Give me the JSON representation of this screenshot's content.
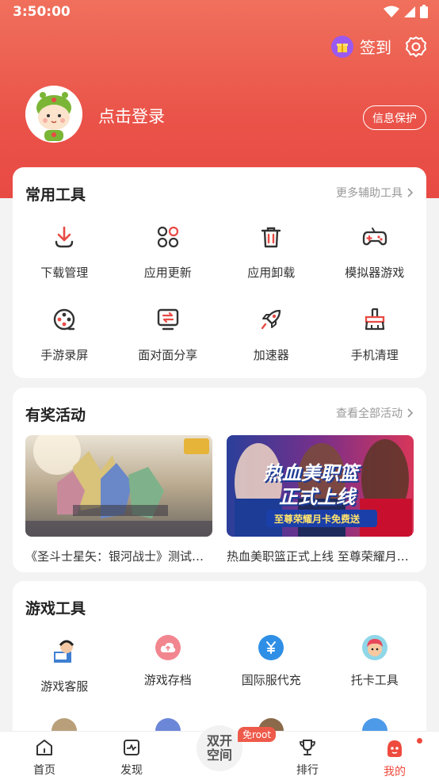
{
  "status_bar": {
    "time": "3:50:00"
  },
  "header": {
    "signin_label": "签到",
    "login_text": "点击登录",
    "privacy_label": "信息保护"
  },
  "common_tools": {
    "title": "常用工具",
    "more": "更多辅助工具",
    "items": [
      {
        "label": "下载管理",
        "icon": "download-icon"
      },
      {
        "label": "应用更新",
        "icon": "app-update-icon"
      },
      {
        "label": "应用卸载",
        "icon": "trash-icon"
      },
      {
        "label": "模拟器游戏",
        "icon": "gamepad-icon"
      },
      {
        "label": "手游录屏",
        "icon": "film-reel-icon"
      },
      {
        "label": "面对面分享",
        "icon": "share-transfer-icon"
      },
      {
        "label": "加速器",
        "icon": "rocket-icon"
      },
      {
        "label": "手机清理",
        "icon": "broom-icon"
      }
    ]
  },
  "activities": {
    "title": "有奖活动",
    "more": "查看全部活动",
    "items": [
      {
        "caption": "《圣斗士星矢：银河战士》测试资格开启"
      },
      {
        "caption": "热血美职篮正式上线 至尊荣耀月卡免费送",
        "banner_line1": "热血美职篮",
        "banner_line2": "正式上线",
        "banner_line3": "至尊荣耀月卡免费送"
      }
    ]
  },
  "game_tools": {
    "title": "游戏工具",
    "items": [
      {
        "label": "游戏客服",
        "icon": "customer-service-icon"
      },
      {
        "label": "游戏存档",
        "icon": "cloud-upload-icon"
      },
      {
        "label": "国际服代充",
        "icon": "yen-icon"
      },
      {
        "label": "托卡工具",
        "icon": "toca-character-icon"
      }
    ]
  },
  "tabbar": {
    "tabs": [
      {
        "label": "首页",
        "icon": "home-icon"
      },
      {
        "label": "发现",
        "icon": "discover-icon"
      },
      {
        "label": "排行",
        "icon": "trophy-icon"
      },
      {
        "label": "我的",
        "icon": "profile-icon"
      }
    ],
    "center_line1": "双开",
    "center_line2": "空间",
    "center_badge": "免root"
  },
  "colors": {
    "accent": "#e84a44",
    "active_tab": "#ee4b3e"
  }
}
